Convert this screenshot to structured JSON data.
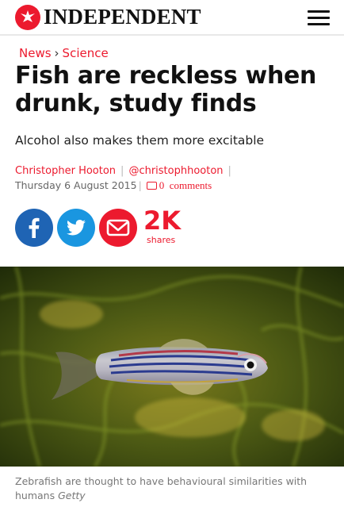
{
  "masthead": {
    "brand": "INDEPENDENT",
    "menu_icon": "hamburger-menu-icon"
  },
  "breadcrumb": {
    "section": "News",
    "separator": "›",
    "subsection": "Science"
  },
  "article": {
    "headline": "Fish are reckless when drunk, study finds",
    "standfirst": "Alcohol also makes them more excitable",
    "author": "Christopher Hooton",
    "author_handle": "@christophhooton",
    "date": "Thursday 6 August 2015",
    "comments_count": "0",
    "comments_label": "comments"
  },
  "share": {
    "count": "2K",
    "label": "shares",
    "buttons": [
      "facebook-icon",
      "twitter-icon",
      "email-icon"
    ],
    "colors": {
      "facebook": "#1f64b4",
      "twitter": "#1a96e0",
      "email": "#ec1a2e"
    }
  },
  "image": {
    "caption": "Zebrafish are thought to have behavioural similarities with humans",
    "credit": "Getty"
  },
  "colors": {
    "accent": "#ec1a2e"
  }
}
